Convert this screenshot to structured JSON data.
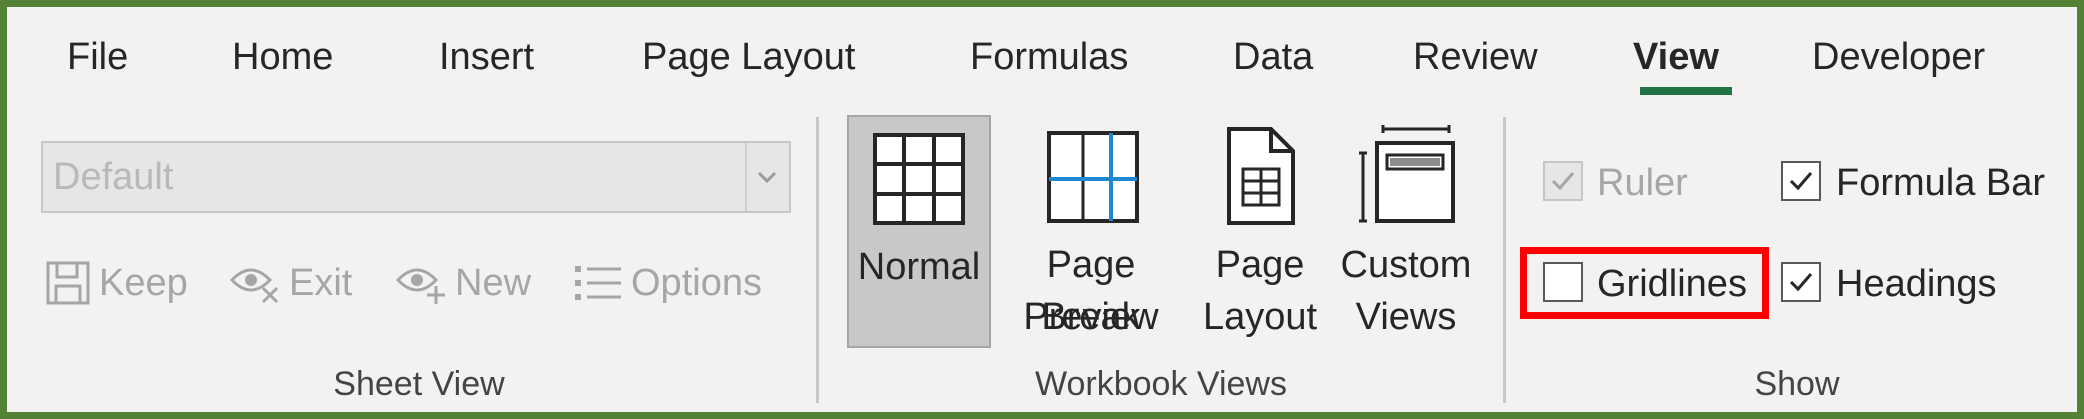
{
  "tabs": [
    "File",
    "Home",
    "Insert",
    "Page Layout",
    "Formulas",
    "Data",
    "Review",
    "View",
    "Developer"
  ],
  "active_tab": "View",
  "sheet_view": {
    "dropdown_value": "Default",
    "buttons": {
      "keep": "Keep",
      "exit": "Exit",
      "new": "New",
      "options": "Options"
    },
    "group_label": "Sheet View"
  },
  "workbook_views": {
    "normal": [
      "Normal"
    ],
    "page_break": [
      "Page Break",
      "Preview"
    ],
    "page_layout": [
      "Page",
      "Layout"
    ],
    "custom_views": [
      "Custom",
      "Views"
    ],
    "group_label": "Workbook Views"
  },
  "show": {
    "ruler": {
      "label": "Ruler",
      "checked": true,
      "disabled": true
    },
    "formula_bar": {
      "label": "Formula Bar",
      "checked": true
    },
    "gridlines": {
      "label": "Gridlines",
      "checked": false
    },
    "headings": {
      "label": "Headings",
      "checked": true
    },
    "group_label": "Show"
  },
  "colors": {
    "frame": "#538135",
    "accent": "#217346",
    "highlight": "#ff0000"
  },
  "icons": {
    "keep": "save-icon",
    "exit": "eye-x-icon",
    "new": "eye-plus-icon",
    "options": "list-icon"
  }
}
